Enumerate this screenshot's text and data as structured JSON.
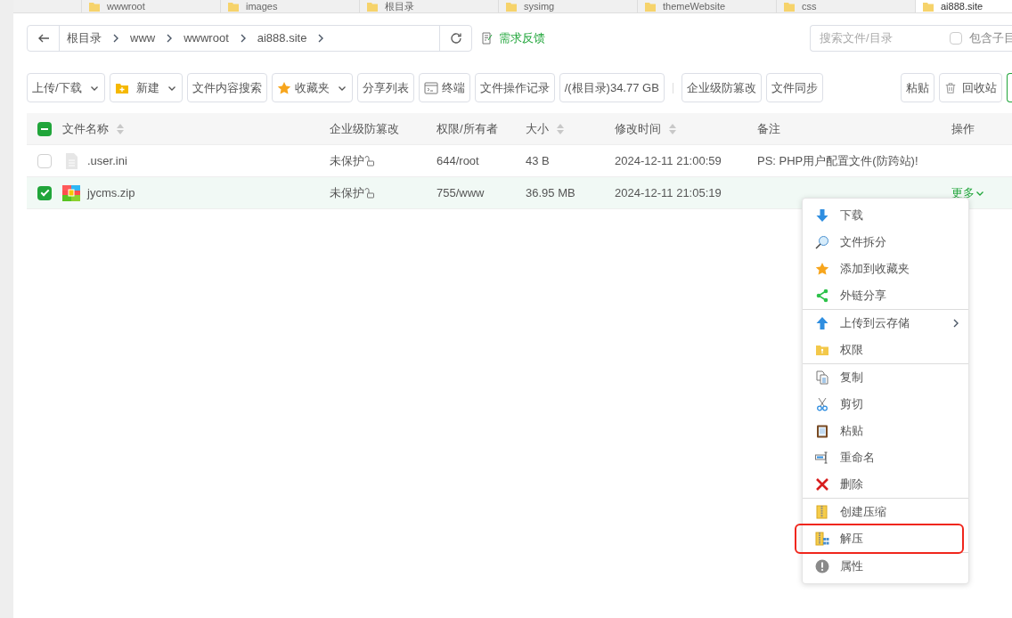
{
  "tabs": [
    {
      "label": "wwwroot",
      "selected": false
    },
    {
      "label": "images",
      "selected": false
    },
    {
      "label": "根目录",
      "selected": false
    },
    {
      "label": "sysimg",
      "selected": false
    },
    {
      "label": "themeWebsite",
      "selected": false
    },
    {
      "label": "css",
      "selected": false
    },
    {
      "label": "ai888.site",
      "selected": true
    }
  ],
  "breadcrumb": [
    "根目录",
    "www",
    "wwwroot",
    "ai888.site"
  ],
  "feedback": "需求反馈",
  "search": {
    "placeholder": "搜索文件/目录",
    "option": {
      "label": "包含子目",
      "checked": false
    }
  },
  "toolbar_left": [
    {
      "label": "上传/下载",
      "kind": "plain",
      "dropdown": true
    },
    {
      "label": "新建",
      "kind": "folder",
      "dropdown": true
    },
    {
      "label": "文件内容搜索",
      "kind": "plain",
      "dropdown": false
    },
    {
      "label": "收藏夹",
      "kind": "star",
      "dropdown": true
    },
    {
      "label": "分享列表",
      "kind": "plain",
      "dropdown": false
    },
    {
      "label": "终端",
      "kind": "terminal",
      "dropdown": false
    },
    {
      "label": "文件操作记录",
      "kind": "plain",
      "dropdown": false
    },
    {
      "label": "/(根目录)34.77 GB",
      "kind": "plain",
      "dropdown": false
    },
    {
      "label": "企业级防篡改",
      "kind": "plain",
      "dropdown": false,
      "divider_before": true
    },
    {
      "label": "文件同步",
      "kind": "plain",
      "dropdown": false
    }
  ],
  "toolbar_right": [
    {
      "label": "粘贴",
      "kind": "plain"
    },
    {
      "label": "回收站",
      "kind": "trash"
    }
  ],
  "table": {
    "header_checkbox": {
      "checked": true
    },
    "columns": [
      {
        "label": "文件名称",
        "sortable": true
      },
      {
        "label": "企业级防篡改",
        "sortable": false
      },
      {
        "label": "权限/所有者",
        "sortable": false
      },
      {
        "label": "大小",
        "sortable": true
      },
      {
        "label": "修改时间",
        "sortable": true
      },
      {
        "label": "备注",
        "sortable": false
      },
      {
        "label": "操作",
        "sortable": false
      }
    ],
    "rows": [
      {
        "checked": false,
        "kind": "file",
        "name": ".user.ini",
        "protect": "未保护",
        "perm": "644/root",
        "size": "43 B",
        "mtime": "2024-12-11 21:00:59",
        "note": "PS: PHP用户配置文件(防跨站)!"
      },
      {
        "checked": true,
        "kind": "zip",
        "name": "jycms.zip",
        "protect": "未保护",
        "perm": "755/www",
        "size": "36.95 MB",
        "mtime": "2024-12-11 21:05:19",
        "action": "更多"
      }
    ]
  },
  "context_menu": [
    [
      {
        "label": "下载",
        "kind": "download",
        "highlighted": false
      },
      {
        "label": "文件拆分",
        "kind": "split",
        "highlighted": false
      },
      {
        "label": "添加到收藏夹",
        "kind": "star",
        "highlighted": false
      },
      {
        "label": "外链分享",
        "kind": "share",
        "highlighted": false
      }
    ],
    [
      {
        "label": "上传到云存储",
        "kind": "upload",
        "highlighted": false,
        "submenu": true
      },
      {
        "label": "权限",
        "kind": "perm",
        "highlighted": false
      }
    ],
    [
      {
        "label": "复制",
        "kind": "copy",
        "highlighted": false
      },
      {
        "label": "剪切",
        "kind": "cut",
        "highlighted": false
      },
      {
        "label": "粘贴",
        "kind": "paste",
        "highlighted": false
      },
      {
        "label": "重命名",
        "kind": "rename",
        "highlighted": false
      },
      {
        "label": "删除",
        "kind": "delete",
        "highlighted": false
      }
    ],
    [
      {
        "label": "创建压缩",
        "kind": "zip",
        "highlighted": false
      },
      {
        "label": "解压",
        "kind": "unzip",
        "highlighted": true
      }
    ],
    [
      {
        "label": "属性",
        "kind": "info",
        "highlighted": false
      }
    ]
  ]
}
